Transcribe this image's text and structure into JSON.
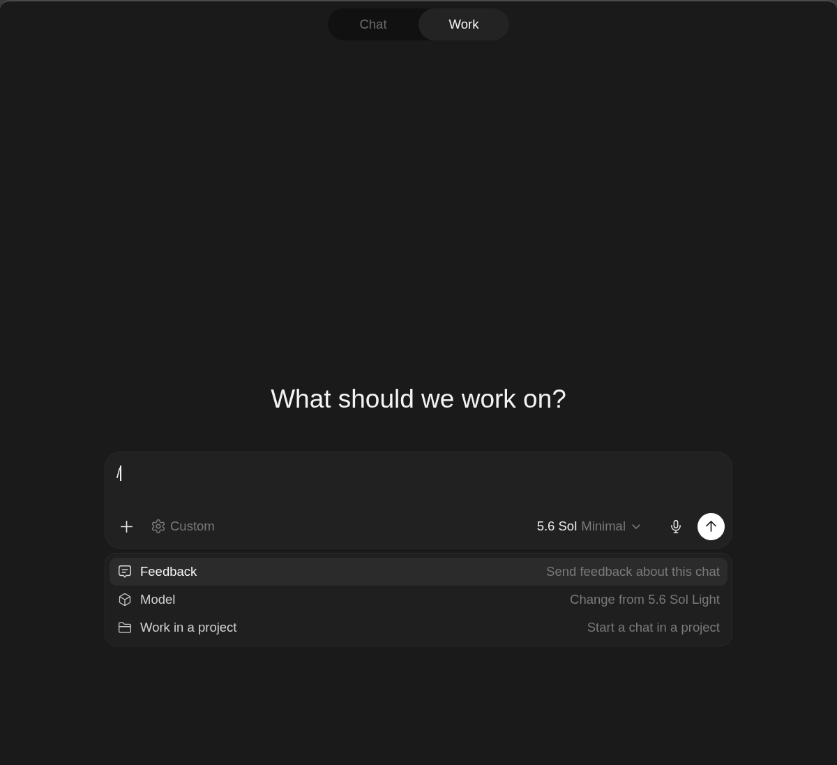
{
  "mode_switch": {
    "tabs": [
      {
        "label": "Chat",
        "selected": false
      },
      {
        "label": "Work",
        "selected": true
      }
    ]
  },
  "heading": "What should we work on?",
  "composer": {
    "value": "/",
    "custom_label": "Custom",
    "model": {
      "name": "5.6 Sol",
      "effort": "Minimal"
    }
  },
  "command_menu": {
    "items": [
      {
        "kind": "feedback",
        "label": "Feedback",
        "description": "Send feedback about this chat",
        "selected": true
      },
      {
        "kind": "model",
        "label": "Model",
        "description": "Change from 5.6 Sol Light",
        "selected": false
      },
      {
        "kind": "project",
        "label": "Work in a project",
        "description": "Start a chat in a project",
        "selected": false
      }
    ]
  }
}
